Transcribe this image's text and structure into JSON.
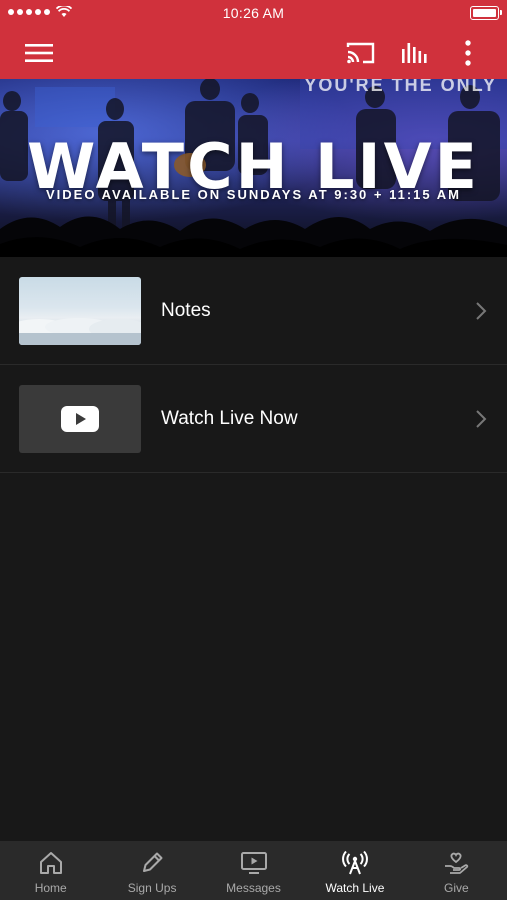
{
  "status_bar": {
    "time": "10:26 AM"
  },
  "header": {
    "menu_icon": "hamburger-icon",
    "cast_icon": "cast-icon",
    "audio_icon": "audio-bars-icon",
    "more_icon": "more-vertical-icon",
    "color": "#d0313c"
  },
  "hero": {
    "title": "WATCH LIVE",
    "subtitle": "VIDEO AVAILABLE ON SUNDAYS AT 9:30 + 11:15 AM",
    "background_text": "YOU'RE THE ONLY"
  },
  "list": {
    "items": [
      {
        "label": "Notes",
        "thumbnail": "clouds-image"
      },
      {
        "label": "Watch Live Now",
        "thumbnail": "youtube-play-icon"
      }
    ]
  },
  "tabbar": {
    "tabs": [
      {
        "label": "Home",
        "icon": "home-icon"
      },
      {
        "label": "Sign Ups",
        "icon": "pencil-icon"
      },
      {
        "label": "Messages",
        "icon": "tv-play-icon"
      },
      {
        "label": "Watch Live",
        "icon": "broadcast-icon",
        "active": true
      },
      {
        "label": "Give",
        "icon": "hand-heart-icon"
      }
    ]
  }
}
